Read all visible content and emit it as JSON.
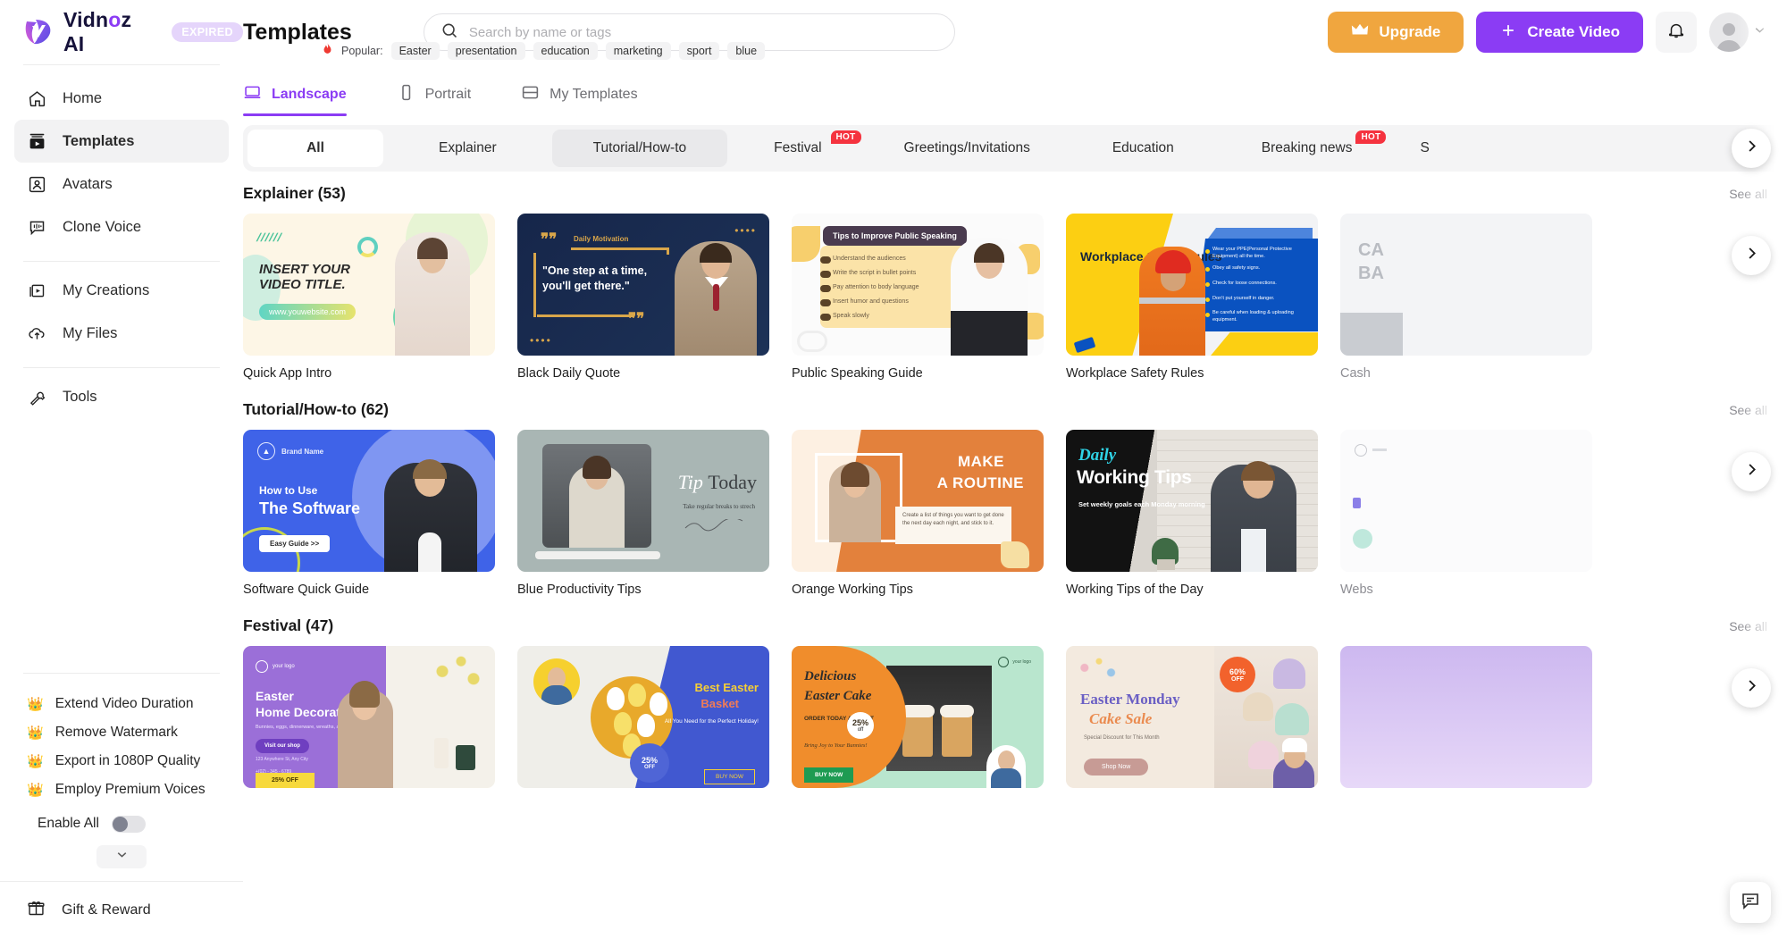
{
  "brand": {
    "name_part1": "Vidn",
    "name_o": "o",
    "name_part2": "z AI",
    "badge": "EXPIRED"
  },
  "sidebar": {
    "nav_primary": [
      {
        "label": "Home",
        "icon": "home-icon"
      },
      {
        "label": "Templates",
        "icon": "templates-icon",
        "active": true
      },
      {
        "label": "Avatars",
        "icon": "avatars-icon"
      },
      {
        "label": "Clone Voice",
        "icon": "clone-voice-icon"
      }
    ],
    "nav_secondary": [
      {
        "label": "My Creations",
        "icon": "my-creations-icon"
      },
      {
        "label": "My Files",
        "icon": "my-files-icon"
      }
    ],
    "nav_tools": [
      {
        "label": "Tools",
        "icon": "tools-icon"
      }
    ],
    "perks": [
      "Extend Video Duration",
      "Remove Watermark",
      "Export in 1080P Quality",
      "Employ Premium Voices"
    ],
    "enable_all_label": "Enable All",
    "enable_all_state": "off",
    "collapse_icon": "chevron-down-icon",
    "gift_label": "Gift & Reward",
    "gift_icon": "gift-icon"
  },
  "header": {
    "title": "Templates",
    "search_placeholder": "Search by name or tags",
    "search_value": "",
    "search_icon": "search-icon",
    "popular_label": "Popular:",
    "popular_icon": "fire-icon",
    "popular_tags": [
      "Easter",
      "presentation",
      "education",
      "marketing",
      "sport",
      "blue"
    ],
    "upgrade_label": "Upgrade",
    "upgrade_icon": "crown-icon",
    "create_label": "Create Video",
    "create_icon": "plus-icon",
    "notification_icon": "bell-icon",
    "avatar_icon": "user-avatar",
    "avatar_chevron": "chevron-down-icon"
  },
  "tabs": [
    {
      "label": "Landscape",
      "icon": "landscape-icon",
      "active": true
    },
    {
      "label": "Portrait",
      "icon": "portrait-icon",
      "active": false
    },
    {
      "label": "My Templates",
      "icon": "my-templates-icon",
      "active": false
    }
  ],
  "categories": [
    {
      "label": "All",
      "state": "selected"
    },
    {
      "label": "Explainer",
      "state": "normal"
    },
    {
      "label": "Tutorial/How-to",
      "state": "hovered"
    },
    {
      "label": "Festival",
      "state": "normal",
      "badge": "HOT"
    },
    {
      "label": "Greetings/Invitations",
      "state": "normal"
    },
    {
      "label": "Education",
      "state": "normal"
    },
    {
      "label": "Breaking news",
      "state": "normal",
      "badge": "HOT"
    },
    {
      "label": "S",
      "state": "normal"
    }
  ],
  "category_next_icon": "chevron-right-icon",
  "sections": [
    {
      "title": "Explainer (53)",
      "see_all": "See all",
      "next_icon": "chevron-right-icon",
      "cards": [
        {
          "name": "Quick App Intro",
          "art": "t1",
          "text": {
            "title": "INSERT YOUR VIDEO TITLE.",
            "url": "www.youwebsite.com"
          }
        },
        {
          "name": "Black Daily Quote",
          "art": "t2",
          "text": {
            "label": "Daily Motivation",
            "quote": "\"One step at a time, you'll get there.\""
          }
        },
        {
          "name": "Public Speaking Guide",
          "art": "t3",
          "text": {
            "pill": "Tips to Improve Public Speaking",
            "items": [
              "Understand the audiences",
              "Write the script in bullet points",
              "Pay attention to body language",
              "Insert humor and questions",
              "Speak slowly"
            ]
          }
        },
        {
          "name": "Workplace Safety Rules",
          "art": "t4",
          "text": {
            "title": "Workplace Safety Rules",
            "items": [
              "Wear your PPE(Personal Protective Equipment) all the time.",
              "Obey all safety signs.",
              "Check for loose connections.",
              "Don't put yourself in danger.",
              "Be careful when loading & uploading equipment."
            ]
          }
        },
        {
          "name": "Cash",
          "art": "pc1",
          "partial": true,
          "text": {
            "line1": "CA",
            "line2": "BA"
          }
        }
      ]
    },
    {
      "title": "Tutorial/How-to (62)",
      "see_all": "See all",
      "next_icon": "chevron-right-icon",
      "cards": [
        {
          "name": "Software Quick Guide",
          "art": "t5",
          "text": {
            "brand": "Brand Name",
            "h1": "How to Use",
            "h2": "The Software",
            "cta": "Easy Guide >>"
          }
        },
        {
          "name": "Blue Productivity Tips",
          "art": "t6",
          "text": {
            "tip": "Tip",
            "today": "Today",
            "sub": "Take regular breaks to strech"
          }
        },
        {
          "name": "Orange Working Tips",
          "art": "t7",
          "text": {
            "h1": "MAKE",
            "h2": "A ROUTINE",
            "note": "Create a list of things you want to get done the next day each night, and stick to it."
          }
        },
        {
          "name": "Working Tips of the Day",
          "art": "t8",
          "text": {
            "daily": "Daily",
            "title": "Working Tips",
            "sub": "Set weekly goals each Monday morning"
          }
        },
        {
          "name": "Webs",
          "art": "pc2",
          "partial": true,
          "text": {}
        }
      ]
    },
    {
      "title": "Festival (47)",
      "see_all": "See all",
      "next_icon": "chevron-right-icon",
      "cards": [
        {
          "name": "",
          "art": "t9",
          "text": {
            "logo": "your logo",
            "h1": "Easter",
            "h2": "Home Decorations",
            "sub": "Bunnies, eggs, dinnerware, wreaths, and more!",
            "btn": "Visit our shop",
            "addr": "123 Anywhere St, Any City",
            "phone": "+(02) - 345 - 6789",
            "off": "25% OFF"
          }
        },
        {
          "name": "",
          "art": "t10",
          "text": {
            "h1": "Best Easter",
            "h2": "Basket",
            "sub": "All You Need for the Perfect Holiday!",
            "badge": "25% OFF",
            "buy": "BUY NOW"
          }
        },
        {
          "name": "",
          "art": "t11",
          "text": {
            "h1": "Delicious",
            "h2": "Easter Cake",
            "order": "ORDER TODAY AND GET",
            "pct": "25%",
            "off": "off",
            "bring": "Bring Joy to Your Bunnies!",
            "buy": "BUY NOW",
            "logo": "your logo"
          }
        },
        {
          "name": "",
          "art": "t12",
          "text": {
            "h1": "Easter Monday",
            "h2": "Cake Sale",
            "sub": "Special Discount for This Month",
            "badge1": "60%",
            "badge2": "OFF",
            "shop": "Shop Now"
          }
        },
        {
          "name": "",
          "art": "pc3",
          "partial": true,
          "text": {}
        }
      ]
    }
  ],
  "chat_fab_icon": "chat-icon",
  "colors": {
    "accent_purple": "#8b3cf4",
    "upgrade_orange": "#f0a63f",
    "hot_red": "#f5333f",
    "crown_gold": "#e8a33d"
  }
}
